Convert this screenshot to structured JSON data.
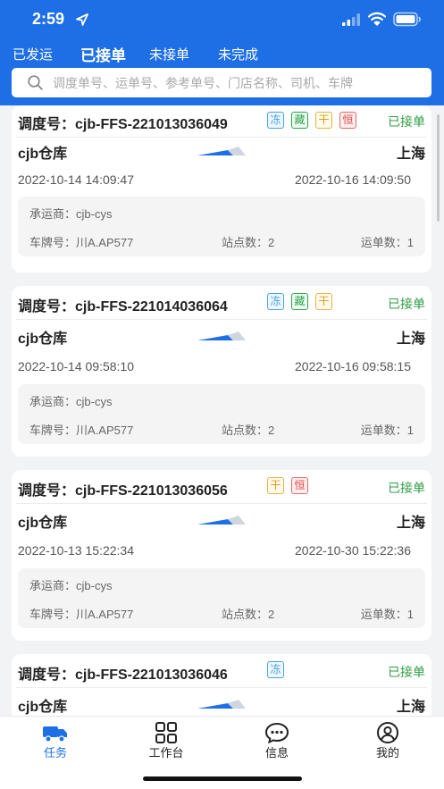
{
  "status_bar": {
    "time": "2:59"
  },
  "tabs": [
    {
      "label": "已发运",
      "active": false
    },
    {
      "label": "已接单",
      "active": true
    },
    {
      "label": "未接单",
      "active": false
    },
    {
      "label": "未完成",
      "active": false
    }
  ],
  "search": {
    "placeholder": "调度单号、运单号、参考单号、门店名称、司机、车牌"
  },
  "labels": {
    "dispatch_prefix": "调度号：",
    "carrier_prefix": "承运商：",
    "plate_prefix": "车牌号：",
    "stops_prefix": "站点数：",
    "orders_prefix": "运单数："
  },
  "cards": [
    {
      "dispatch_no": "cjb-FFS-221013036049",
      "badges": [
        "冻",
        "藏",
        "干",
        "恒"
      ],
      "status": "已接单",
      "origin": "cjb仓库",
      "destination": "上海",
      "start_time": "2022-10-14 14:09:47",
      "end_time": "2022-10-16 14:09:50",
      "carrier": "cjb-cys",
      "plate": "川A.AP577",
      "stops": "2",
      "orders": "1"
    },
    {
      "dispatch_no": "cjb-FFS-221014036064",
      "badges": [
        "冻",
        "藏",
        "干"
      ],
      "status": "已接单",
      "origin": "cjb仓库",
      "destination": "上海",
      "start_time": "2022-10-14 09:58:10",
      "end_time": "2022-10-16 09:58:15",
      "carrier": "cjb-cys",
      "plate": "川A.AP577",
      "stops": "2",
      "orders": "1"
    },
    {
      "dispatch_no": "cjb-FFS-221013036056",
      "badges": [
        "干",
        "恒"
      ],
      "status": "已接单",
      "origin": "cjb仓库",
      "destination": "上海",
      "start_time": "2022-10-13 15:22:34",
      "end_time": "2022-10-30 15:22:36",
      "carrier": "cjb-cys",
      "plate": "川A.AP577",
      "stops": "2",
      "orders": "1"
    },
    {
      "dispatch_no": "cjb-FFS-221013036046",
      "badges": [
        "冻"
      ],
      "status": "已接单",
      "origin": "cjb仓库",
      "destination": "上海",
      "start_time": "",
      "end_time": "",
      "carrier": "",
      "plate": "",
      "stops": "",
      "orders": ""
    }
  ],
  "nav": [
    {
      "label": "任务",
      "icon": "truck-icon",
      "active": true
    },
    {
      "label": "工作台",
      "icon": "grid-icon",
      "active": false
    },
    {
      "label": "信息",
      "icon": "chat-icon",
      "active": false
    },
    {
      "label": "我的",
      "icon": "user-icon",
      "active": false
    }
  ],
  "colors": {
    "primary": "#1e6fe6",
    "status_green": "#2f9e44",
    "background": "#f2f3f5"
  }
}
